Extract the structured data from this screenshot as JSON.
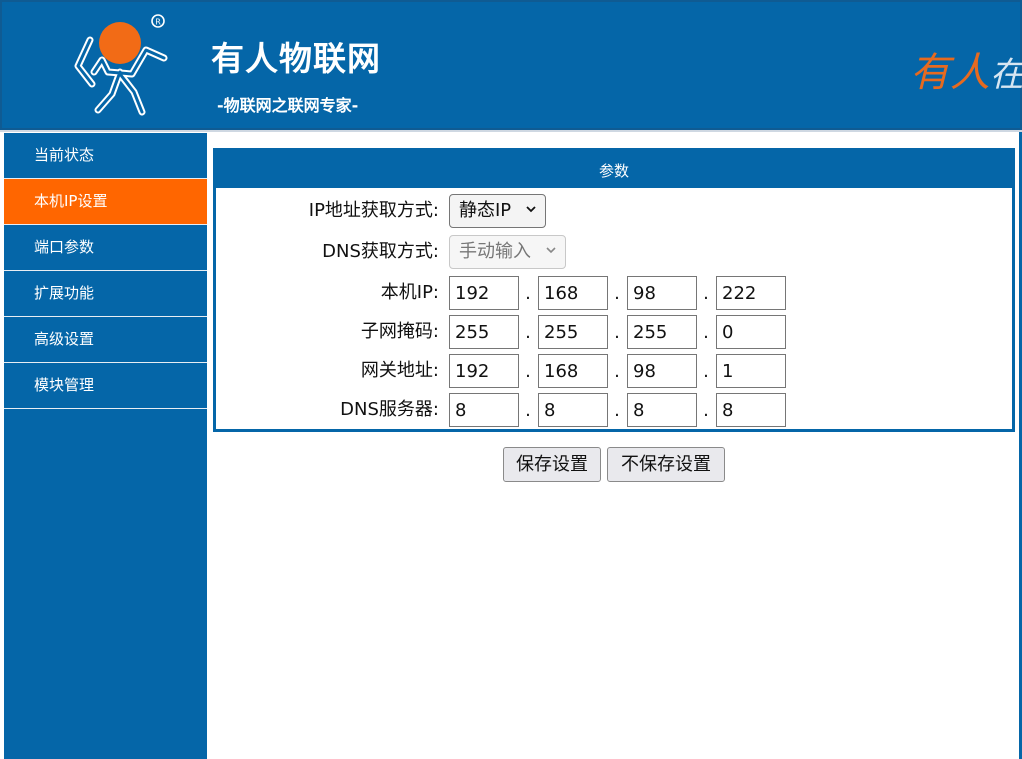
{
  "header": {
    "title": "有人物联网",
    "subtitle": "-物联网之联网专家-",
    "slogan_main": "有人",
    "slogan_tail": "在",
    "logo_icon": "person-running-logo-icon",
    "colors": {
      "primary": "#0566a8",
      "accent": "#ff6600",
      "logo_orange": "#f26b16"
    }
  },
  "sidebar": {
    "items": [
      {
        "label": "当前状态",
        "active": false
      },
      {
        "label": "本机IP设置",
        "active": true
      },
      {
        "label": "端口参数",
        "active": false
      },
      {
        "label": "扩展功能",
        "active": false
      },
      {
        "label": "高级设置",
        "active": false
      },
      {
        "label": "模块管理",
        "active": false
      }
    ]
  },
  "panel": {
    "title": "参数",
    "ip_mode": {
      "label": "IP地址获取方式:",
      "value": "静态IP",
      "icon": "chevron-down-icon"
    },
    "dns_mode": {
      "label": "DNS获取方式:",
      "value": "手动输入",
      "disabled": true,
      "icon": "chevron-down-icon"
    },
    "local_ip": {
      "label": "本机IP:",
      "octets": [
        "192",
        "168",
        "98",
        "222"
      ]
    },
    "subnet_mask": {
      "label": "子网掩码:",
      "octets": [
        "255",
        "255",
        "255",
        "0"
      ]
    },
    "gateway": {
      "label": "网关地址:",
      "octets": [
        "192",
        "168",
        "98",
        "1"
      ]
    },
    "dns_server": {
      "label": "DNS服务器:",
      "octets": [
        "8",
        "8",
        "8",
        "8"
      ]
    },
    "separator": "."
  },
  "buttons": {
    "save": "保存设置",
    "dont_save": "不保存设置"
  }
}
